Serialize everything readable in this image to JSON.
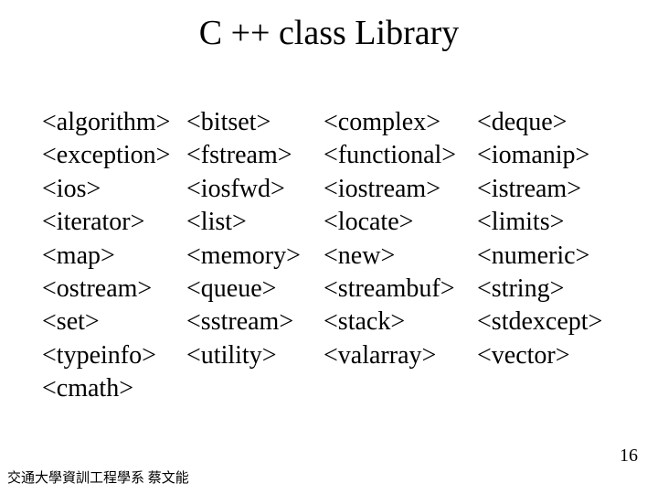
{
  "title": "C ++ class Library",
  "rows": [
    {
      "c1": "<algorithm>",
      "c2": "<bitset>",
      "c3": "<complex>",
      "c4": "<deque>"
    },
    {
      "c1": "<exception>",
      "c2": "<fstream>",
      "c3": "<functional>",
      "c4": "<iomanip>"
    },
    {
      "c1": "<ios>",
      "c2": " <iosfwd>",
      "c3": "<iostream>",
      "c4": "<istream>"
    },
    {
      "c1": "<iterator>",
      "c2": "<list>",
      "c3": "<locate>",
      "c4": "<limits>"
    },
    {
      "c1": "<map>",
      "c2": "<memory>",
      "c3": "<new>",
      "c4": "<numeric>"
    },
    {
      "c1": "<ostream>",
      "c2": "<queue>",
      "c3": "<streambuf>",
      "c4": "<string>"
    },
    {
      "c1": "<set>",
      "c2": " <sstream>",
      "c3": " <stack>",
      "c4": "<stdexcept>"
    },
    {
      "c1": "<typeinfo>",
      "c2": " <utility>",
      "c3": "<valarray>",
      "c4": "<vector>"
    },
    {
      "c1": "<cmath>",
      "c2": "",
      "c3": "",
      "c4": ""
    }
  ],
  "footer": "交通大學資訓工程學系 蔡文能",
  "page_number": "16"
}
